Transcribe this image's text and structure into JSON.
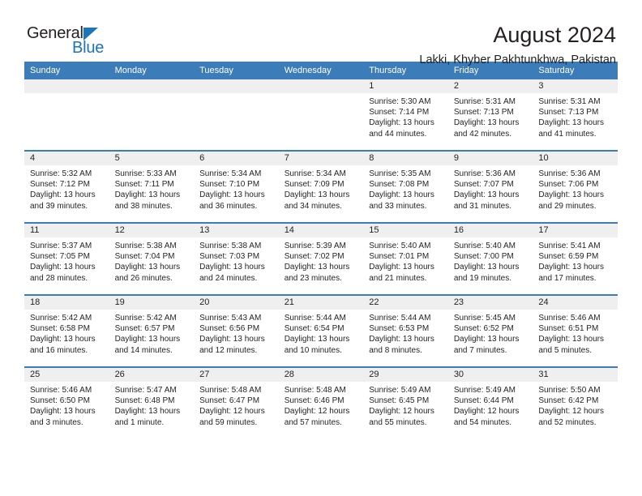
{
  "logo": {
    "word_one": "General",
    "word_two": "Blue",
    "accent_color": "#1b75bb"
  },
  "header": {
    "title": "August 2024",
    "subtitle": "Lakki, Khyber Pakhtunkhwa, Pakistan"
  },
  "theme": {
    "header_blue": "#3b7cb9",
    "daynum_band": "#efefef",
    "text": "#231f20"
  },
  "calendar": {
    "weekday_headers": [
      "Sunday",
      "Monday",
      "Tuesday",
      "Wednesday",
      "Thursday",
      "Friday",
      "Saturday"
    ],
    "weeks": [
      [
        {
          "day": "",
          "sunrise": "",
          "sunset": "",
          "daylight_a": "",
          "daylight_b": ""
        },
        {
          "day": "",
          "sunrise": "",
          "sunset": "",
          "daylight_a": "",
          "daylight_b": ""
        },
        {
          "day": "",
          "sunrise": "",
          "sunset": "",
          "daylight_a": "",
          "daylight_b": ""
        },
        {
          "day": "",
          "sunrise": "",
          "sunset": "",
          "daylight_a": "",
          "daylight_b": ""
        },
        {
          "day": "1",
          "sunrise": "Sunrise: 5:30 AM",
          "sunset": "Sunset: 7:14 PM",
          "daylight_a": "Daylight: 13 hours",
          "daylight_b": "and 44 minutes."
        },
        {
          "day": "2",
          "sunrise": "Sunrise: 5:31 AM",
          "sunset": "Sunset: 7:13 PM",
          "daylight_a": "Daylight: 13 hours",
          "daylight_b": "and 42 minutes."
        },
        {
          "day": "3",
          "sunrise": "Sunrise: 5:31 AM",
          "sunset": "Sunset: 7:13 PM",
          "daylight_a": "Daylight: 13 hours",
          "daylight_b": "and 41 minutes."
        }
      ],
      [
        {
          "day": "4",
          "sunrise": "Sunrise: 5:32 AM",
          "sunset": "Sunset: 7:12 PM",
          "daylight_a": "Daylight: 13 hours",
          "daylight_b": "and 39 minutes."
        },
        {
          "day": "5",
          "sunrise": "Sunrise: 5:33 AM",
          "sunset": "Sunset: 7:11 PM",
          "daylight_a": "Daylight: 13 hours",
          "daylight_b": "and 38 minutes."
        },
        {
          "day": "6",
          "sunrise": "Sunrise: 5:34 AM",
          "sunset": "Sunset: 7:10 PM",
          "daylight_a": "Daylight: 13 hours",
          "daylight_b": "and 36 minutes."
        },
        {
          "day": "7",
          "sunrise": "Sunrise: 5:34 AM",
          "sunset": "Sunset: 7:09 PM",
          "daylight_a": "Daylight: 13 hours",
          "daylight_b": "and 34 minutes."
        },
        {
          "day": "8",
          "sunrise": "Sunrise: 5:35 AM",
          "sunset": "Sunset: 7:08 PM",
          "daylight_a": "Daylight: 13 hours",
          "daylight_b": "and 33 minutes."
        },
        {
          "day": "9",
          "sunrise": "Sunrise: 5:36 AM",
          "sunset": "Sunset: 7:07 PM",
          "daylight_a": "Daylight: 13 hours",
          "daylight_b": "and 31 minutes."
        },
        {
          "day": "10",
          "sunrise": "Sunrise: 5:36 AM",
          "sunset": "Sunset: 7:06 PM",
          "daylight_a": "Daylight: 13 hours",
          "daylight_b": "and 29 minutes."
        }
      ],
      [
        {
          "day": "11",
          "sunrise": "Sunrise: 5:37 AM",
          "sunset": "Sunset: 7:05 PM",
          "daylight_a": "Daylight: 13 hours",
          "daylight_b": "and 28 minutes."
        },
        {
          "day": "12",
          "sunrise": "Sunrise: 5:38 AM",
          "sunset": "Sunset: 7:04 PM",
          "daylight_a": "Daylight: 13 hours",
          "daylight_b": "and 26 minutes."
        },
        {
          "day": "13",
          "sunrise": "Sunrise: 5:38 AM",
          "sunset": "Sunset: 7:03 PM",
          "daylight_a": "Daylight: 13 hours",
          "daylight_b": "and 24 minutes."
        },
        {
          "day": "14",
          "sunrise": "Sunrise: 5:39 AM",
          "sunset": "Sunset: 7:02 PM",
          "daylight_a": "Daylight: 13 hours",
          "daylight_b": "and 23 minutes."
        },
        {
          "day": "15",
          "sunrise": "Sunrise: 5:40 AM",
          "sunset": "Sunset: 7:01 PM",
          "daylight_a": "Daylight: 13 hours",
          "daylight_b": "and 21 minutes."
        },
        {
          "day": "16",
          "sunrise": "Sunrise: 5:40 AM",
          "sunset": "Sunset: 7:00 PM",
          "daylight_a": "Daylight: 13 hours",
          "daylight_b": "and 19 minutes."
        },
        {
          "day": "17",
          "sunrise": "Sunrise: 5:41 AM",
          "sunset": "Sunset: 6:59 PM",
          "daylight_a": "Daylight: 13 hours",
          "daylight_b": "and 17 minutes."
        }
      ],
      [
        {
          "day": "18",
          "sunrise": "Sunrise: 5:42 AM",
          "sunset": "Sunset: 6:58 PM",
          "daylight_a": "Daylight: 13 hours",
          "daylight_b": "and 16 minutes."
        },
        {
          "day": "19",
          "sunrise": "Sunrise: 5:42 AM",
          "sunset": "Sunset: 6:57 PM",
          "daylight_a": "Daylight: 13 hours",
          "daylight_b": "and 14 minutes."
        },
        {
          "day": "20",
          "sunrise": "Sunrise: 5:43 AM",
          "sunset": "Sunset: 6:56 PM",
          "daylight_a": "Daylight: 13 hours",
          "daylight_b": "and 12 minutes."
        },
        {
          "day": "21",
          "sunrise": "Sunrise: 5:44 AM",
          "sunset": "Sunset: 6:54 PM",
          "daylight_a": "Daylight: 13 hours",
          "daylight_b": "and 10 minutes."
        },
        {
          "day": "22",
          "sunrise": "Sunrise: 5:44 AM",
          "sunset": "Sunset: 6:53 PM",
          "daylight_a": "Daylight: 13 hours",
          "daylight_b": "and 8 minutes."
        },
        {
          "day": "23",
          "sunrise": "Sunrise: 5:45 AM",
          "sunset": "Sunset: 6:52 PM",
          "daylight_a": "Daylight: 13 hours",
          "daylight_b": "and 7 minutes."
        },
        {
          "day": "24",
          "sunrise": "Sunrise: 5:46 AM",
          "sunset": "Sunset: 6:51 PM",
          "daylight_a": "Daylight: 13 hours",
          "daylight_b": "and 5 minutes."
        }
      ],
      [
        {
          "day": "25",
          "sunrise": "Sunrise: 5:46 AM",
          "sunset": "Sunset: 6:50 PM",
          "daylight_a": "Daylight: 13 hours",
          "daylight_b": "and 3 minutes."
        },
        {
          "day": "26",
          "sunrise": "Sunrise: 5:47 AM",
          "sunset": "Sunset: 6:48 PM",
          "daylight_a": "Daylight: 13 hours",
          "daylight_b": "and 1 minute."
        },
        {
          "day": "27",
          "sunrise": "Sunrise: 5:48 AM",
          "sunset": "Sunset: 6:47 PM",
          "daylight_a": "Daylight: 12 hours",
          "daylight_b": "and 59 minutes."
        },
        {
          "day": "28",
          "sunrise": "Sunrise: 5:48 AM",
          "sunset": "Sunset: 6:46 PM",
          "daylight_a": "Daylight: 12 hours",
          "daylight_b": "and 57 minutes."
        },
        {
          "day": "29",
          "sunrise": "Sunrise: 5:49 AM",
          "sunset": "Sunset: 6:45 PM",
          "daylight_a": "Daylight: 12 hours",
          "daylight_b": "and 55 minutes."
        },
        {
          "day": "30",
          "sunrise": "Sunrise: 5:49 AM",
          "sunset": "Sunset: 6:44 PM",
          "daylight_a": "Daylight: 12 hours",
          "daylight_b": "and 54 minutes."
        },
        {
          "day": "31",
          "sunrise": "Sunrise: 5:50 AM",
          "sunset": "Sunset: 6:42 PM",
          "daylight_a": "Daylight: 12 hours",
          "daylight_b": "and 52 minutes."
        }
      ]
    ]
  }
}
